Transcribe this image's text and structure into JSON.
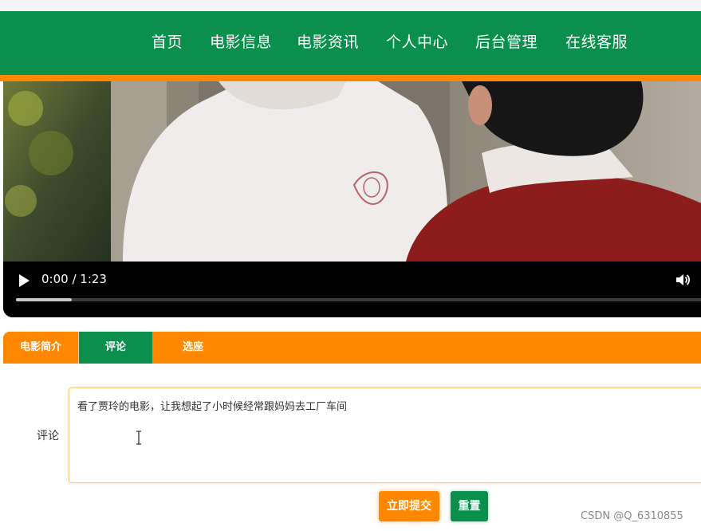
{
  "nav": {
    "items": [
      {
        "label": "首页"
      },
      {
        "label": "电影信息"
      },
      {
        "label": "电影资讯"
      },
      {
        "label": "个人中心"
      },
      {
        "label": "后台管理"
      },
      {
        "label": "在线客服"
      }
    ]
  },
  "video": {
    "time": "0:00 / 1:23",
    "progress_fraction": 0.08,
    "icons": [
      "play-icon",
      "volume-icon"
    ]
  },
  "tabs": [
    {
      "label": "电影简介"
    },
    {
      "label": "评论",
      "active": true
    },
    {
      "label": "选座"
    }
  ],
  "form": {
    "comment_label": "评论",
    "comment_value": "看了贾玲的电影，让我想起了小时候经常跟妈妈去工厂车间",
    "submit_label": "立即提交",
    "reset_label": "重置"
  },
  "watermark": "CSDN @Q_6310855",
  "colors": {
    "nav_bg": "#0b8f4d",
    "accent_orange": "#ff8800",
    "accent_green": "#0b8f4d"
  }
}
